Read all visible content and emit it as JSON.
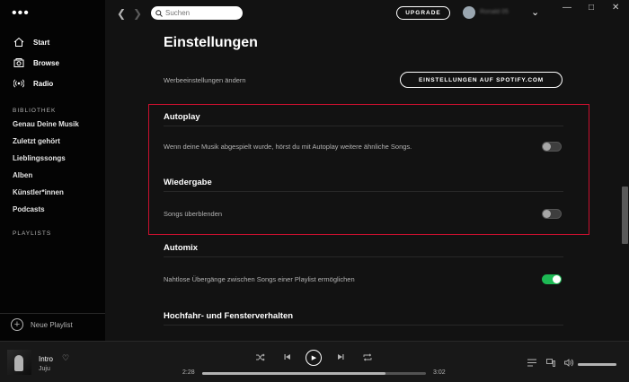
{
  "sidebar": {
    "menu_icon": "more-dots-icon",
    "nav": [
      {
        "label": "Start",
        "icon": "home-icon"
      },
      {
        "label": "Browse",
        "icon": "browse-icon"
      },
      {
        "label": "Radio",
        "icon": "radio-icon"
      }
    ],
    "library_label": "BIBLIOTHEK",
    "library": [
      "Genau Deine Musik",
      "Zuletzt gehört",
      "Lieblingssongs",
      "Alben",
      "Künstler*innen",
      "Podcasts"
    ],
    "playlists_label": "PLAYLISTS",
    "new_playlist": "Neue Playlist"
  },
  "topbar": {
    "search_placeholder": "Suchen",
    "upgrade": "UPGRADE",
    "username": "Ronald 05"
  },
  "main": {
    "title": "Einstellungen",
    "ad_settings_text": "Werbeeinstellungen ändern",
    "ad_settings_button": "EINSTELLUNGEN AUF SPOTIFY.COM",
    "sections": [
      {
        "heading": "Autoplay",
        "row": "Wenn deine Musik abgespielt wurde, hörst du mit Autoplay weitere ähnliche Songs.",
        "enabled": false
      },
      {
        "heading": "Wiedergabe",
        "row": "Songs überblenden",
        "enabled": false
      },
      {
        "heading": "Automix",
        "row": "Nahtlose Übergänge zwischen Songs einer Playlist ermöglichen",
        "enabled": true
      },
      {
        "heading": "Hochfahr- und Fensterverhalten",
        "row": "",
        "enabled": false
      }
    ],
    "highlight_color": "#c8102e"
  },
  "player": {
    "track": "Intro",
    "artist": "Juju",
    "elapsed": "2:28",
    "duration": "3:02",
    "progress": 0.82,
    "volume": 1.0,
    "accent": "#1db954"
  }
}
